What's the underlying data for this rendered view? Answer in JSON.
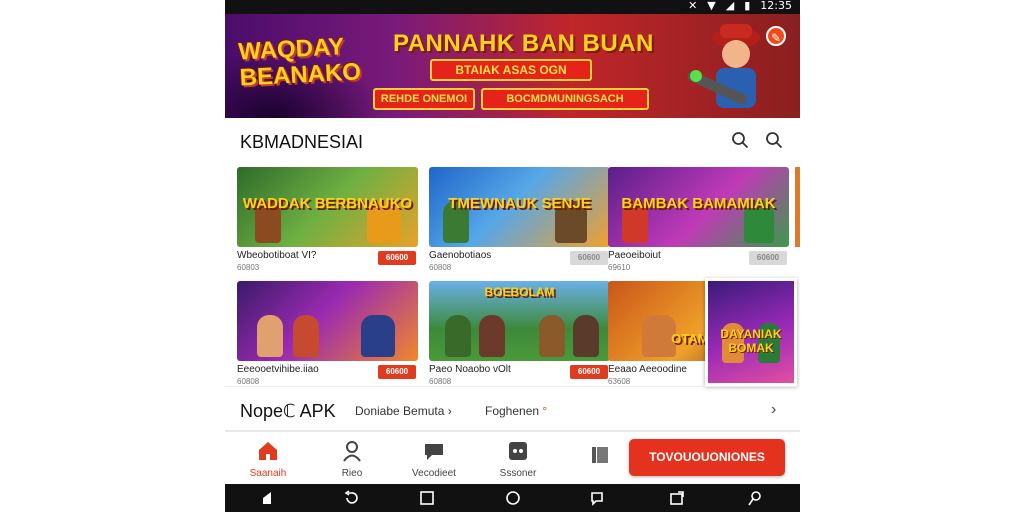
{
  "status_bar": {
    "time": "12:35"
  },
  "banner": {
    "logo_text": "WAQDAY BEANAKO",
    "headline": "PANNAHK BAN BUAN",
    "pill_main": "BTAIAK ASAS OGN",
    "pill_left": "REHDE ONEMOI",
    "pill_right": "BOCMDMUNINGSACH"
  },
  "header": {
    "title": "KBMADNESIAI"
  },
  "cards": [
    {
      "thumb_title": "WADDAK BERBNAUKO",
      "name": "Wbeobotiboat VI?",
      "sub": "60803",
      "button": "60600",
      "button_style": "red"
    },
    {
      "thumb_title": "TMEWNAUK SENJE",
      "name": "Gaenobotiaos",
      "sub": "60808",
      "button": "60600",
      "button_style": "grey"
    },
    {
      "thumb_title": "BAMBAK BAMAMIAK",
      "name": "Paeoeiboiut",
      "sub": "69610",
      "button": "60600",
      "button_style": "grey"
    },
    {
      "thumb_title": "",
      "name": "Eeeooetvihibe.iiao",
      "sub": "60808",
      "button": "60600",
      "button_style": "red"
    },
    {
      "thumb_title": "BOEBOLAM",
      "name": "Paeo Noaobo vOlt",
      "sub": "60808",
      "button": "60600",
      "button_style": "red"
    },
    {
      "thumb_title": "OTAMES",
      "name": "Eeaao Aeeoodine",
      "sub": "63608",
      "button": "",
      "button_style": "none"
    }
  ],
  "overlay_card": {
    "title": "DAYANIAK BOMAK"
  },
  "section": {
    "title": "Nopeℂ APK",
    "link1": "Doniabe Bemuta",
    "link2": "Foghenen"
  },
  "bottom_nav": {
    "items": [
      {
        "label": "Saanaih",
        "icon": "home-icon"
      },
      {
        "label": "Rieo",
        "icon": "person-icon"
      },
      {
        "label": "Vecodieet",
        "icon": "chat-icon"
      },
      {
        "label": "Sssoner",
        "icon": "gamepad-icon"
      }
    ],
    "cta_label": "TOVOUOUONIONES"
  },
  "colors": {
    "accent": "#e4321f",
    "banner_gold": "#ffd21a"
  }
}
